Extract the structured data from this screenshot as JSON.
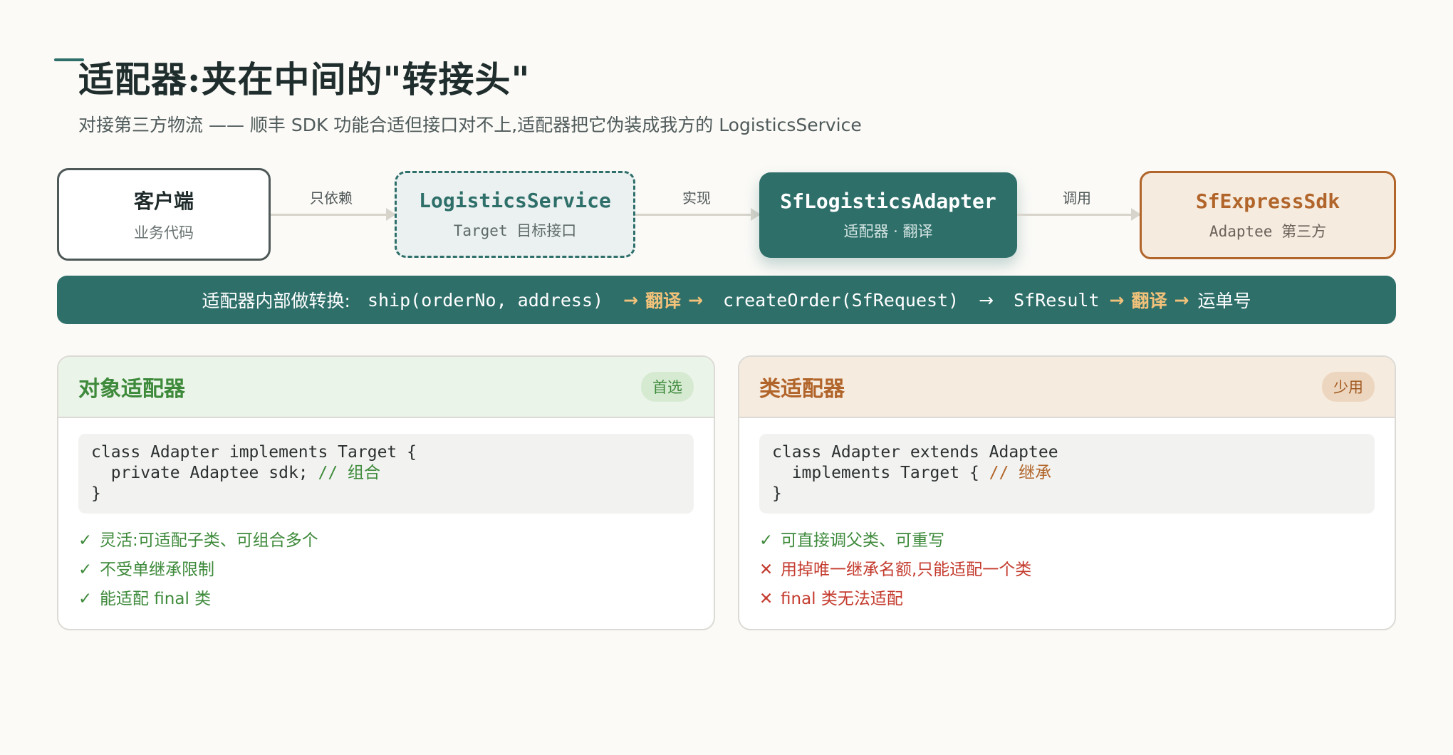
{
  "header": {
    "title": "适配器:夹在中间的\"转接头\"",
    "subtitle": "对接第三方物流 —— 顺丰 SDK 功能合适但接口对不上,适配器把它伪装成我方的 LogisticsService"
  },
  "flow": {
    "client": {
      "title": "客户端",
      "sub": "业务代码"
    },
    "target": {
      "title": "LogisticsService",
      "sub": "Target 目标接口"
    },
    "adapter": {
      "title": "SfLogisticsAdapter",
      "sub": "适配器 · 翻译"
    },
    "sdk": {
      "title": "SfExpressSdk",
      "sub": "Adaptee 第三方"
    },
    "edges": [
      "只依赖",
      "实现",
      "调用"
    ]
  },
  "band": {
    "label": "适配器内部做转换:",
    "ship_call": "ship(orderNo, address)",
    "translate": "翻译",
    "create_call": "createOrder(SfRequest)",
    "result": "SfResult",
    "waybill": "运单号",
    "arrow": "→"
  },
  "cards": {
    "object": {
      "title": "对象适配器",
      "badge": "首选",
      "code": {
        "line1": "class Adapter implements Target {",
        "line2": "  private Adaptee sdk; ",
        "line2_comment": "// 组合",
        "line3": "}"
      },
      "points": [
        {
          "mark": "✓",
          "text": "灵活:可适配子类、可组合多个"
        },
        {
          "mark": "✓",
          "text": "不受单继承限制"
        },
        {
          "mark": "✓",
          "text": "能适配 final 类"
        }
      ]
    },
    "class": {
      "title": "类适配器",
      "badge": "少用",
      "code": {
        "line1": "class Adapter extends Adaptee",
        "line2": "  implements Target { ",
        "line2_comment": "// 继承",
        "line3": "}"
      },
      "points": [
        {
          "mark": "✓",
          "text": "可直接调父类、可重写"
        },
        {
          "mark": "✕",
          "text": "用掉唯一继承名额,只能适配一个类"
        },
        {
          "mark": "✕",
          "text": "final 类无法适配"
        }
      ]
    }
  },
  "colors": {
    "teal": "#2e6f6a",
    "orange": "#b1652a",
    "green": "#3e8a3b",
    "red": "#c43b2e",
    "highlight": "#f2c27a"
  }
}
